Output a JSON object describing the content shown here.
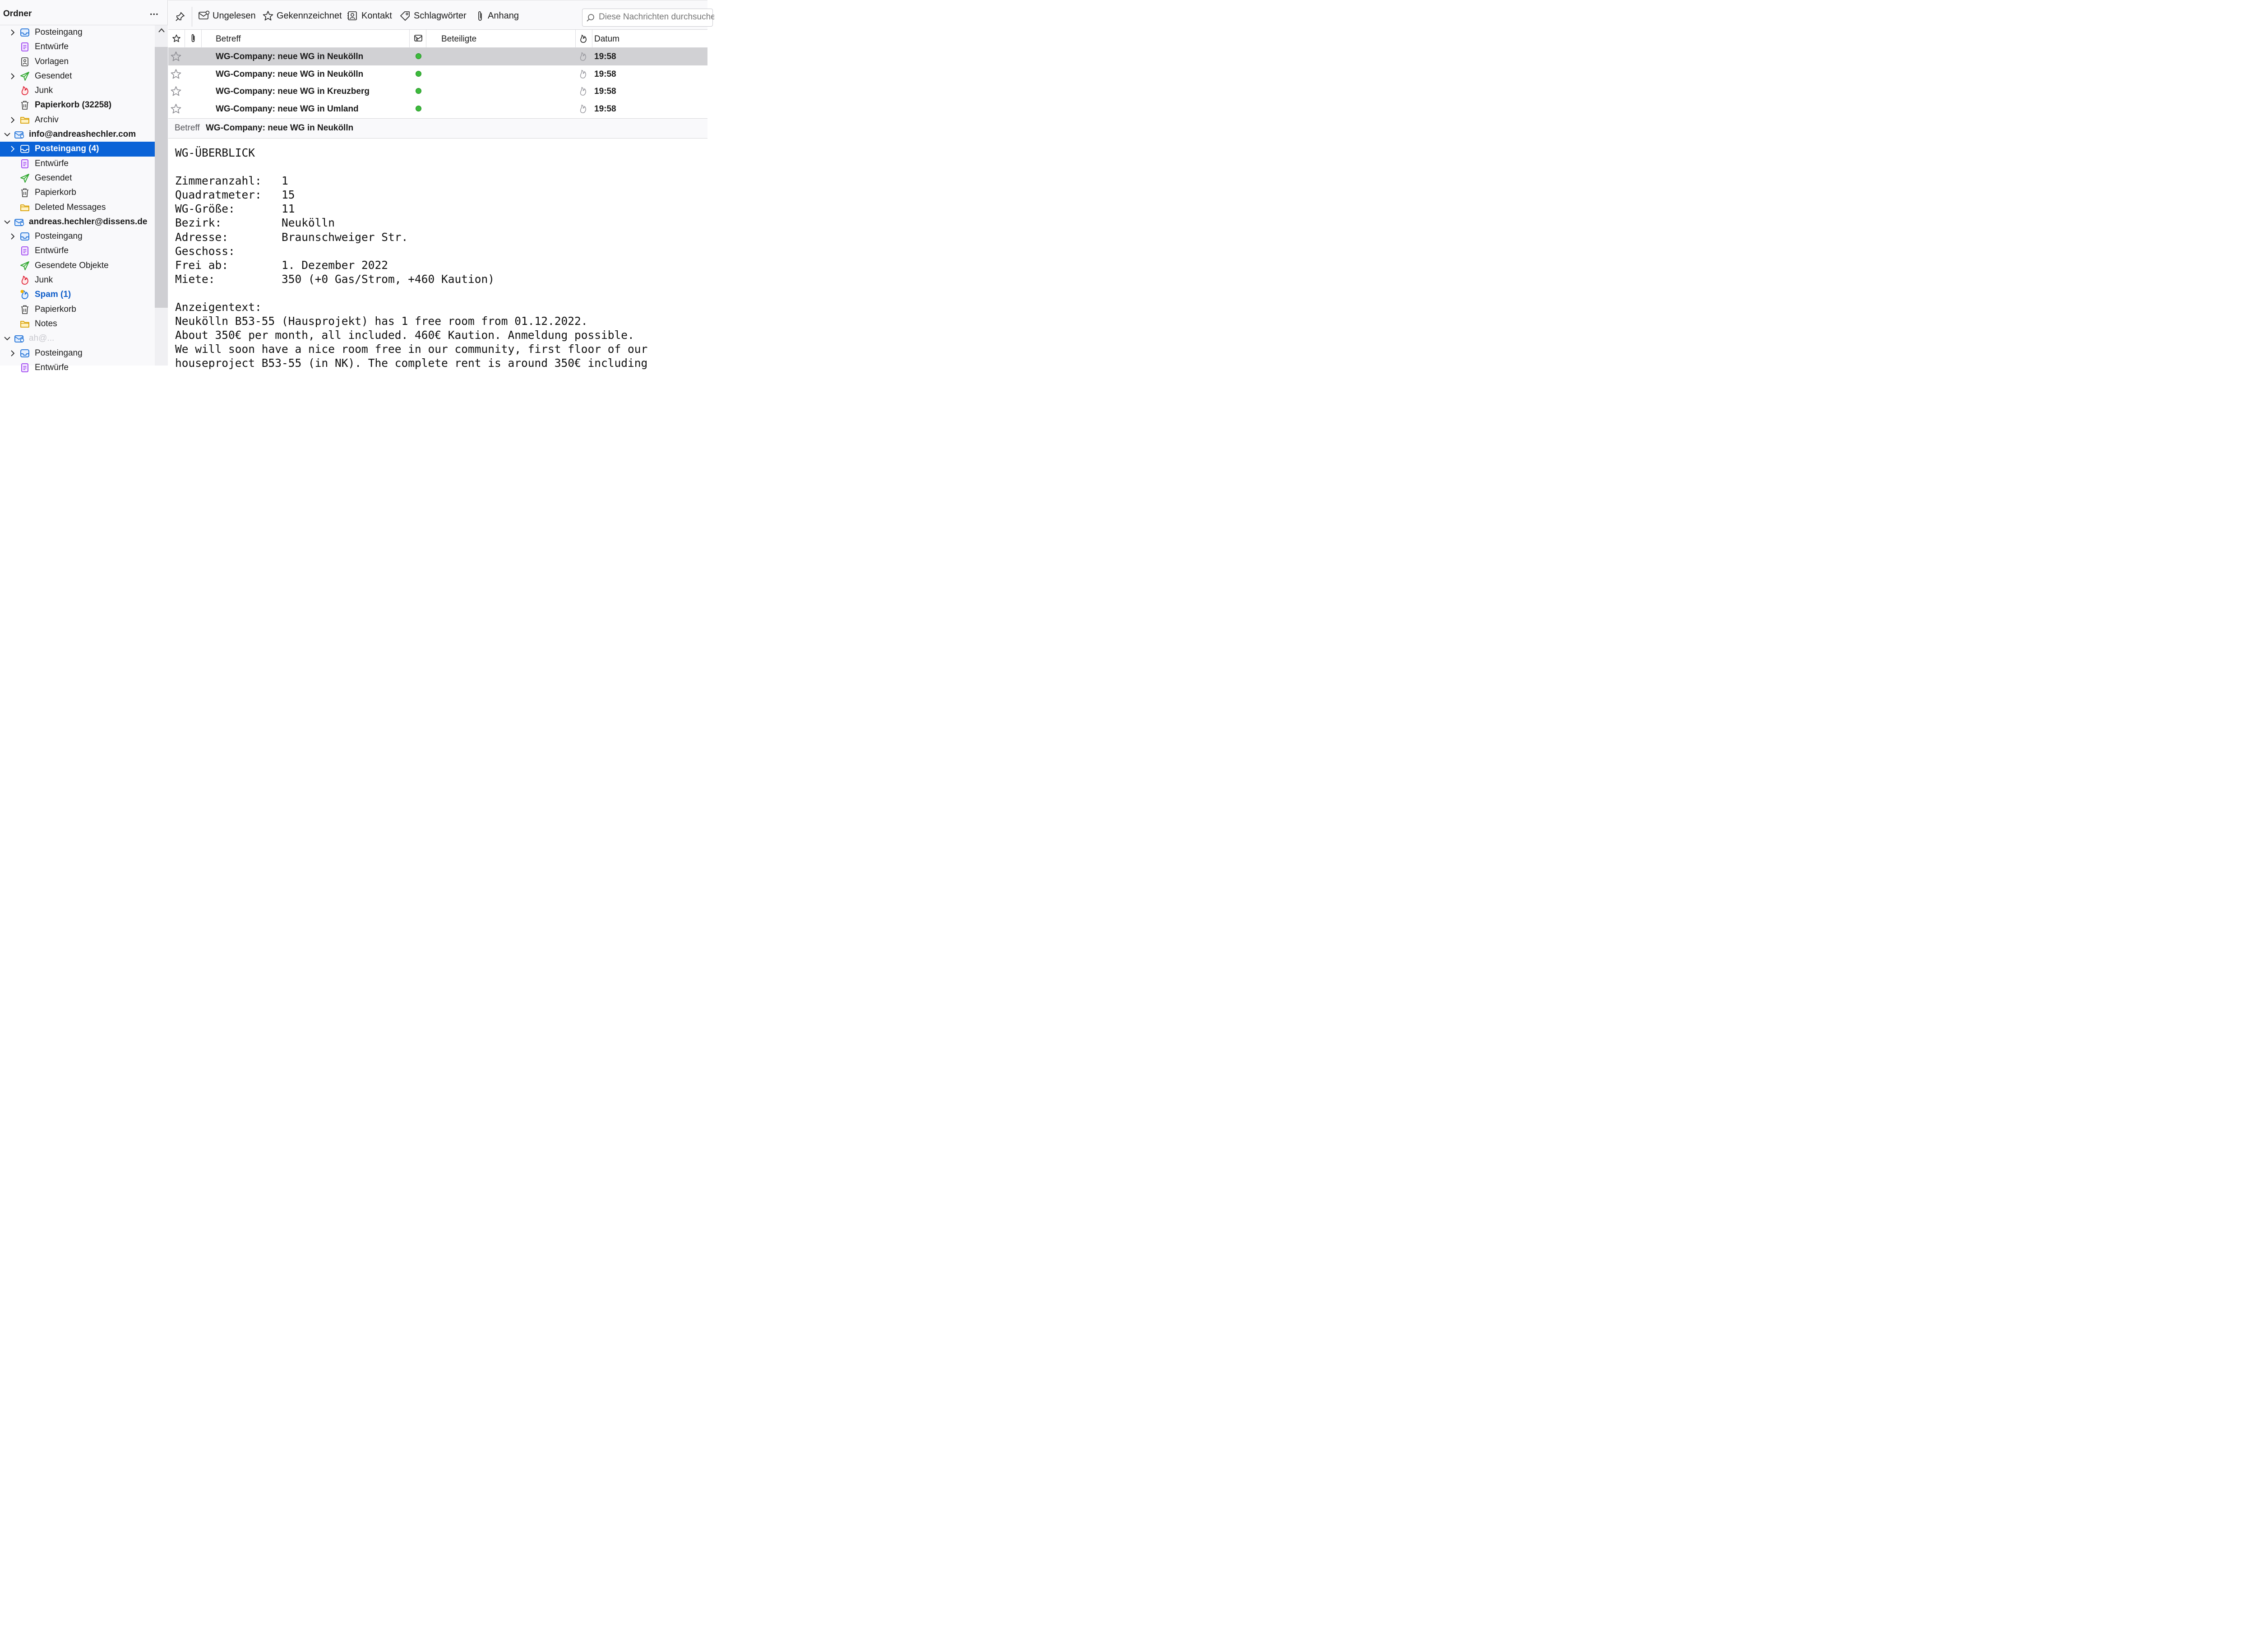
{
  "sidebar": {
    "title": "Ordner",
    "menu_label": "...",
    "folders": [
      {
        "label": "Posteingang",
        "icon": "inbox-icon",
        "indent": 1,
        "twisty": "collapsed"
      },
      {
        "label": "Entwürfe",
        "icon": "drafts-icon",
        "indent": 1
      },
      {
        "label": "Vorlagen",
        "icon": "templates-icon",
        "indent": 1
      },
      {
        "label": "Gesendet",
        "icon": "sent-icon",
        "indent": 1,
        "twisty": "collapsed"
      },
      {
        "label": "Junk",
        "icon": "junk-icon",
        "indent": 1
      },
      {
        "label": "Papierkorb (32258)",
        "icon": "trash-icon",
        "indent": 1,
        "style": "bold"
      },
      {
        "label": "Archiv",
        "icon": "folder-icon",
        "indent": 1,
        "twisty": "collapsed"
      },
      {
        "label": "info@andreashechler.com",
        "icon": "account-icon",
        "indent": 0,
        "twisty": "expanded",
        "style": "bold"
      },
      {
        "label": "Posteingang (4)",
        "icon": "inbox-icon",
        "indent": 1,
        "twisty": "collapsed",
        "style": "bold",
        "selected": true
      },
      {
        "label": "Entwürfe",
        "icon": "drafts-icon",
        "indent": 1
      },
      {
        "label": "Gesendet",
        "icon": "sent-icon",
        "indent": 1
      },
      {
        "label": "Papierkorb",
        "icon": "trash-icon",
        "indent": 1
      },
      {
        "label": "Deleted Messages",
        "icon": "folder-icon",
        "indent": 1
      },
      {
        "label": "andreas.hechler@dissens.de",
        "icon": "account-icon",
        "indent": 0,
        "twisty": "expanded",
        "style": "bold"
      },
      {
        "label": "Posteingang",
        "icon": "inbox-icon",
        "indent": 1,
        "twisty": "collapsed"
      },
      {
        "label": "Entwürfe",
        "icon": "drafts-icon",
        "indent": 1
      },
      {
        "label": "Gesendete Objekte",
        "icon": "sent-icon",
        "indent": 1
      },
      {
        "label": "Junk",
        "icon": "junk-icon",
        "indent": 1
      },
      {
        "label": "Spam (1)",
        "icon": "spam-icon",
        "indent": 1,
        "style": "blue"
      },
      {
        "label": "Papierkorb",
        "icon": "trash-icon",
        "indent": 1
      },
      {
        "label": "Notes",
        "icon": "folder-icon",
        "indent": 1
      },
      {
        "label": "ah@...",
        "icon": "account-icon",
        "indent": 0,
        "twisty": "expanded",
        "style": "faded"
      },
      {
        "label": "Posteingang",
        "icon": "inbox-icon",
        "indent": 1,
        "twisty": "collapsed"
      },
      {
        "label": "Entwürfe",
        "icon": "drafts-icon",
        "indent": 1
      }
    ]
  },
  "toolbar": {
    "buttons": [
      {
        "label": "Ungelesen",
        "icon": "unread-icon"
      },
      {
        "label": "Gekennzeichnet",
        "icon": "star-icon"
      },
      {
        "label": "Kontakt",
        "icon": "contact-icon"
      },
      {
        "label": "Schlagwörter",
        "icon": "tag-icon"
      },
      {
        "label": "Anhang",
        "icon": "attachment-icon"
      }
    ],
    "search_placeholder": "Diese Nachrichten durchsuchen"
  },
  "columns": {
    "subject": "Betreff",
    "participants": "Beteiligte",
    "date": "Datum"
  },
  "messages": [
    {
      "subject": "WG-Company: neue WG in Neukölln",
      "date": "19:58",
      "selected": true
    },
    {
      "subject": "WG-Company: neue WG in Neukölln",
      "date": "19:58"
    },
    {
      "subject": "WG-Company: neue WG in Kreuzberg",
      "date": "19:58"
    },
    {
      "subject": "WG-Company: neue WG in Umland",
      "date": "19:58"
    }
  ],
  "preview": {
    "subject_label": "Betreff",
    "subject_value": "WG-Company: neue WG in Neukölln",
    "body_lines": [
      "WG-ÜBERBLICK",
      "",
      "Zimmeranzahl:   1",
      "Quadratmeter:   15",
      "WG-Größe:       11",
      "Bezirk:         Neukölln",
      "Adresse:        Braunschweiger Str.",
      "Geschoss:",
      "Frei ab:        1. Dezember 2022",
      "Miete:          350 (+0 Gas/Strom, +460 Kaution)",
      "",
      "Anzeigentext:",
      "Neukölln B53-55 (Hausprojekt) has 1 free room from 01.12.2022.",
      "About 350€ per month, all included. 460€ Kaution. Anmeldung possible.",
      "We will soon have a nice room free in our community, first floor of our",
      "houseproject B53-55 (in NK). The complete rent is around 350€ including"
    ]
  }
}
